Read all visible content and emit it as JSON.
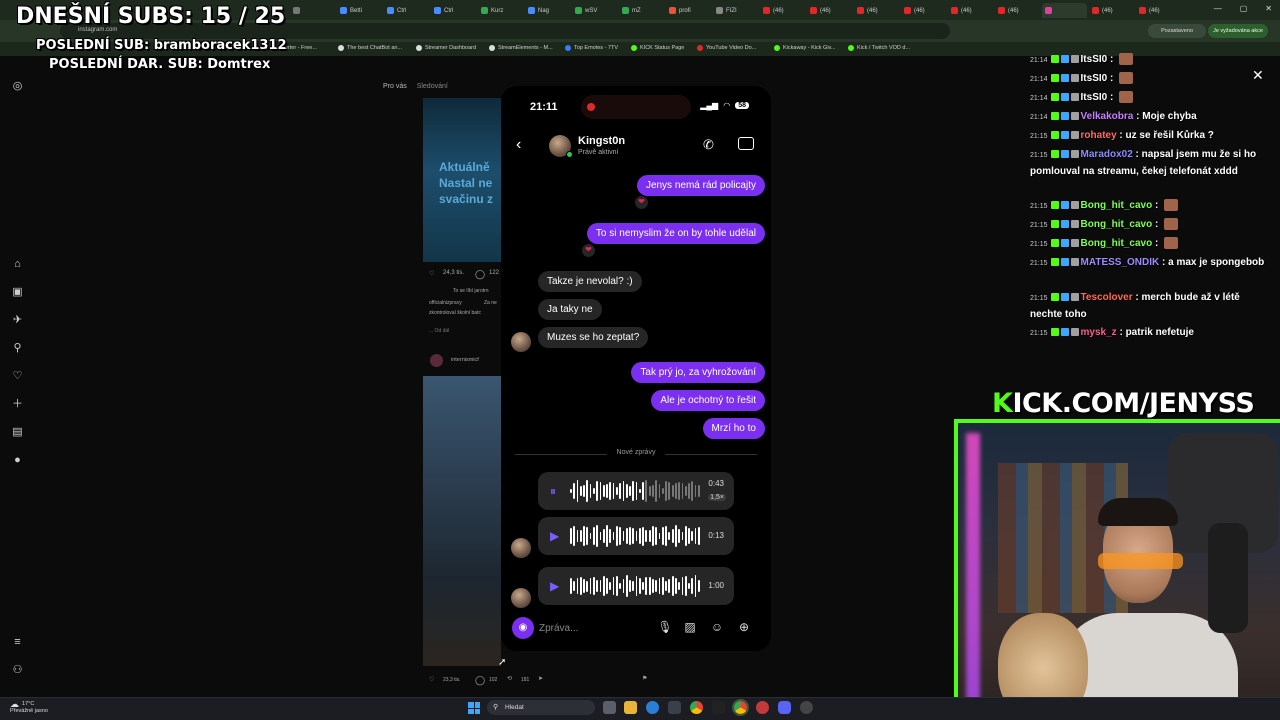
{
  "browser": {
    "tabs": [
      "",
      "Betti",
      "Ctrl",
      "Ctrl",
      "Kurz",
      "Nag",
      "wSV",
      "mZ",
      "profi",
      "FIZI",
      "(46)",
      "(46)",
      "(46)",
      "(46)",
      "(46)",
      "(46)",
      "",
      "(46)",
      "(46)"
    ],
    "url": "instagram.com",
    "bookmarks": [
      "Converter - Free...",
      "The best ChatBot an...",
      "Streamer Dashboard",
      "StreamElements - M...",
      "Top Emotes - 7TV",
      "KICK Status Page",
      "YouTube Video Do...",
      "Kickaway - Kick Giv...",
      "Kick / Twitch VOD d..."
    ],
    "profile_label": "Pozastaveno",
    "update_label": "Je vyžadována akce"
  },
  "overlay": {
    "subs": "DNEŠNÍ SUBS: 15 / 25",
    "last_sub": "POSLEDNÍ SUB: bramboracek1312",
    "last_gift": "POSLEDNÍ DAR. SUB: Domtrex"
  },
  "instagram": {
    "feed_tabs": [
      "Pro vás",
      "Sledování"
    ],
    "post1": {
      "image_text": [
        "Aktuálně",
        "Nastal ne",
        "svačinu z"
      ],
      "likes": "24,3 tis.",
      "comments": "122",
      "liked_by": "To se líbí jarotrn",
      "author": "officialnizpravy",
      "caption": "Za ne",
      "caption2": "zkontroloval školní batc",
      "more": "... Od dál"
    },
    "post2": {
      "author": "internismicf",
      "likes": "23,3 tis.",
      "comments": "102",
      "reposts": "181"
    }
  },
  "phone": {
    "time": "21:11",
    "battery": "58",
    "contact_name": "Kingst0n",
    "contact_status": "Právě aktivní",
    "messages": [
      {
        "dir": "out",
        "text": "Jenys nemá rád policajty",
        "reaction": "❤"
      },
      {
        "dir": "out",
        "text": "To si nemyslim že on by tohle udělal",
        "reaction": "❤"
      },
      {
        "dir": "in",
        "text": "Takze je nevolal? :)"
      },
      {
        "dir": "in",
        "text": "Ja taky ne"
      },
      {
        "dir": "in",
        "text": "Muzes se ho zeptat?"
      },
      {
        "dir": "out",
        "text": "Tak prý jo, za vyhrožování"
      },
      {
        "dir": "out",
        "text": "Ale je ochotný to řešit"
      },
      {
        "dir": "out",
        "text": "Mrzí ho to"
      }
    ],
    "new_messages_label": "Nové zprávy",
    "voice_messages": [
      {
        "duration": "0:43",
        "speed": "1,5×",
        "state": "pause"
      },
      {
        "duration": "0:13",
        "state": "play"
      },
      {
        "duration": "1:00",
        "state": "play"
      }
    ],
    "composer_placeholder": "Zpráva..."
  },
  "chat": {
    "lines": [
      {
        "time": "21:14",
        "user": "ItsSI0",
        "msg": "",
        "color": "#ffffff",
        "emote": true
      },
      {
        "time": "21:14",
        "user": "ItsSI0",
        "msg": "",
        "color": "#ffffff",
        "emote": true
      },
      {
        "time": "21:14",
        "user": "ItsSI0",
        "msg": "",
        "color": "#ffffff",
        "emote": true
      },
      {
        "time": "21:14",
        "user": "Velkakobra",
        "msg": "Moje chyba",
        "color": "#c77dff"
      },
      {
        "time": "21:15",
        "user": "rohatey",
        "msg": "uz se řešil Kůrka ?",
        "color": "#ff6b6b"
      },
      {
        "time": "21:15",
        "user": "Maradox02",
        "msg": "napsal jsem mu že si ho pomlouval na streamu, čekej telefonát xddd",
        "color": "#8b8bff"
      },
      {
        "time": "21:15",
        "user": "Bong_hit_cavo",
        "msg": "",
        "color": "#7dff4f",
        "emote": true
      },
      {
        "time": "21:15",
        "user": "Bong_hit_cavo",
        "msg": "",
        "color": "#7dff4f",
        "emote": true
      },
      {
        "time": "21:15",
        "user": "Bong_hit_cavo",
        "msg": "",
        "color": "#7dff4f",
        "emote": true
      },
      {
        "time": "21:15",
        "user": "MATESS_ONDIK",
        "msg": "a max je spongebob",
        "color": "#9f8bff"
      },
      {
        "time": "21:15",
        "user": "Tescolover",
        "msg": "merch bude až v létě nechte toho",
        "color": "#ff6b4f"
      },
      {
        "time": "21:15",
        "user": "mysk_z",
        "msg": "patrik nefetuje",
        "color": "#ff5a8a"
      }
    ]
  },
  "stream": {
    "kick_url_k": "K",
    "kick_url_rest": "ICK.COM/JENYSS",
    "accent": "#53fc18"
  },
  "taskbar": {
    "weather_temp": "17°C",
    "weather_desc": "Převážně jasno",
    "search_label": "Hledat"
  }
}
